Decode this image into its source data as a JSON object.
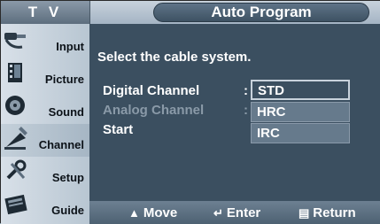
{
  "window": {
    "tv_label": "T V",
    "title": "Auto Program"
  },
  "sidebar": {
    "items": [
      {
        "label": "Input",
        "icon": "input-plug-icon"
      },
      {
        "label": "Picture",
        "icon": "picture-film-icon"
      },
      {
        "label": "Sound",
        "icon": "sound-speaker-icon"
      },
      {
        "label": "Channel",
        "icon": "channel-satellite-icon"
      },
      {
        "label": "Setup",
        "icon": "setup-wrench-icon"
      },
      {
        "label": "Guide",
        "icon": "guide-program-icon"
      }
    ],
    "selected": "Channel"
  },
  "main": {
    "prompt": "Select the cable system.",
    "rows": [
      {
        "label": "Digital Channel",
        "color": "#ffffff"
      },
      {
        "label": "Analog Channel",
        "color": "#8a9aa8"
      },
      {
        "label": "Start",
        "color": "#ffffff"
      }
    ],
    "colon": ":",
    "dropdown": {
      "options": [
        "STD",
        "HRC",
        "IRC"
      ],
      "selected": "STD"
    }
  },
  "footer": {
    "move_label": "Move",
    "enter_label": "Enter",
    "return_label": "Return"
  },
  "colors": {
    "panel_bg": "#3b4f60",
    "highlight": "#c8d2dc",
    "text": "#ffffff"
  }
}
